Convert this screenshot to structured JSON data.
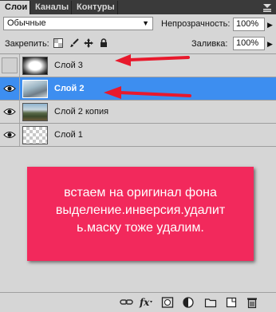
{
  "tabs": [
    {
      "label": "Слои"
    },
    {
      "label": "Каналы"
    },
    {
      "label": "Контуры"
    }
  ],
  "panel_menu_icon": "panel-menu-icon",
  "blend_mode": {
    "value": "Обычные"
  },
  "opacity": {
    "label": "Непрозрачность:",
    "value": "100%"
  },
  "lock": {
    "label": "Закрепить:"
  },
  "fill": {
    "label": "Заливка:",
    "value": "100%"
  },
  "layers": [
    {
      "name": "Слой 3",
      "visible": false,
      "selected": false,
      "thumbnail": "radial-mask"
    },
    {
      "name": "Слой 2",
      "visible": true,
      "selected": true,
      "thumbnail": "photo-sky"
    },
    {
      "name": "Слой 2 копия",
      "visible": true,
      "selected": false,
      "thumbnail": "photo-landscape"
    },
    {
      "name": "Слой 1",
      "visible": true,
      "selected": false,
      "thumbnail": "transparent"
    }
  ],
  "annotation": {
    "lines": [
      "встаем на оригинал фона",
      "выделение.инверсия.удалит",
      "ь.маску тоже удалим."
    ]
  },
  "colors": {
    "selection": "#3d8ef0",
    "annotation_bg": "#f2295c",
    "arrow": "#e8192c"
  },
  "bottom_icons": [
    "link-layers-icon",
    "fx-icon",
    "add-mask-icon",
    "adjustment-layer-icon",
    "new-group-icon",
    "new-layer-icon",
    "delete-layer-icon"
  ]
}
